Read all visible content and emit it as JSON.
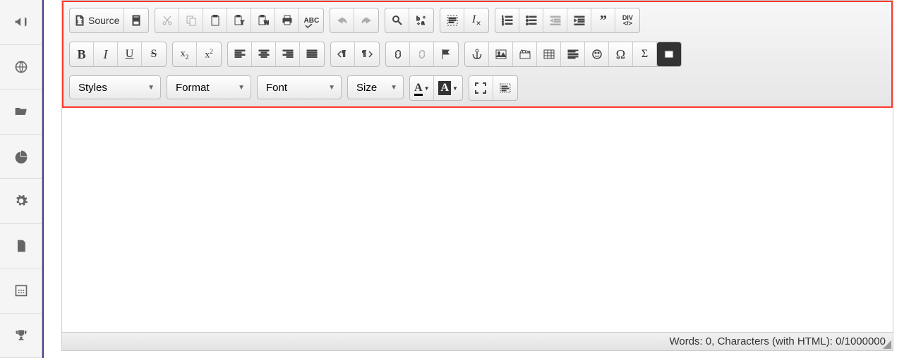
{
  "sidebar": {
    "items": [
      {
        "name": "announce"
      },
      {
        "name": "globe"
      },
      {
        "name": "folder"
      },
      {
        "name": "chart"
      },
      {
        "name": "settings"
      },
      {
        "name": "document"
      },
      {
        "name": "calendar"
      },
      {
        "name": "trophy"
      }
    ]
  },
  "toolbar": {
    "source_label": "Source",
    "styles_label": "Styles",
    "format_label": "Format",
    "font_label": "Font",
    "size_label": "Size",
    "spellcheck_label": "ABC",
    "div_label_top": "DIV",
    "div_label_bottom": "</>"
  },
  "statusbar": {
    "text": "Words: 0, Characters (with HTML): 0/1000000"
  }
}
